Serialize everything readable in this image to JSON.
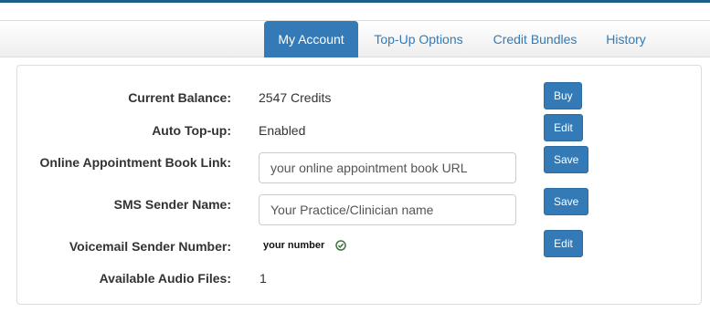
{
  "nav": {
    "tabs": [
      {
        "label": "My Account",
        "active": true
      },
      {
        "label": "Top-Up Options",
        "active": false
      },
      {
        "label": "Credit Bundles",
        "active": false
      },
      {
        "label": "History",
        "active": false
      }
    ]
  },
  "account": {
    "balance": {
      "label": "Current Balance:",
      "value": "2547 Credits",
      "button": "Buy"
    },
    "auto_topup": {
      "label": "Auto Top-up:",
      "value": "Enabled",
      "button": "Edit"
    },
    "booking_link": {
      "label": "Online Appointment Book Link:",
      "placeholder": "your online appointment book URL",
      "button": "Save"
    },
    "sms_sender": {
      "label": "SMS Sender Name:",
      "placeholder": "Your Practice/Clinician name",
      "button": "Save"
    },
    "voicemail": {
      "label": "Voicemail Sender Number:",
      "value": "your number",
      "icon": "check-circle-icon",
      "button": "Edit"
    },
    "audio_files": {
      "label": "Available Audio Files:",
      "value": "1"
    }
  },
  "colors": {
    "primary": "#337ab7",
    "top_accent": "#1a5f86",
    "check": "#3c763d"
  }
}
